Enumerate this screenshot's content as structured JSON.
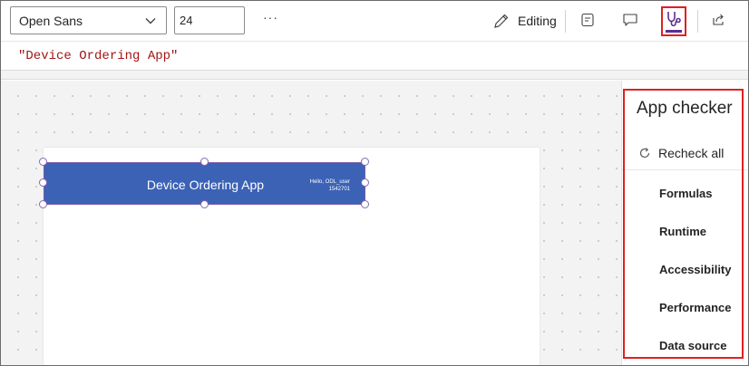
{
  "toolbar": {
    "font_family_value": "Open Sans",
    "font_size_value": "24",
    "more_label": "···",
    "editing_label": "Editing"
  },
  "formula": {
    "text": "\"Device Ordering App\""
  },
  "canvas": {
    "header_title": "Device Ordering App",
    "header_user_line1": "Hello, ODL_user",
    "header_user_line2": "1542701"
  },
  "app_checker": {
    "title": "App checker",
    "recheck_label": "Recheck all",
    "categories": [
      "Formulas",
      "Runtime",
      "Accessibility",
      "Performance",
      "Data source"
    ]
  },
  "icons": {
    "font_dropdown": "chevron-down-icon",
    "editing": "pencil-icon",
    "tree": "notes-icon",
    "comments": "comment-icon",
    "checker": "stethoscope-icon",
    "share": "share-icon",
    "recheck": "refresh-icon"
  },
  "colors": {
    "accent": "#5c2d91",
    "header_fill": "#3b62b5",
    "highlight_box": "#e02020",
    "formula_string": "#a31515"
  }
}
